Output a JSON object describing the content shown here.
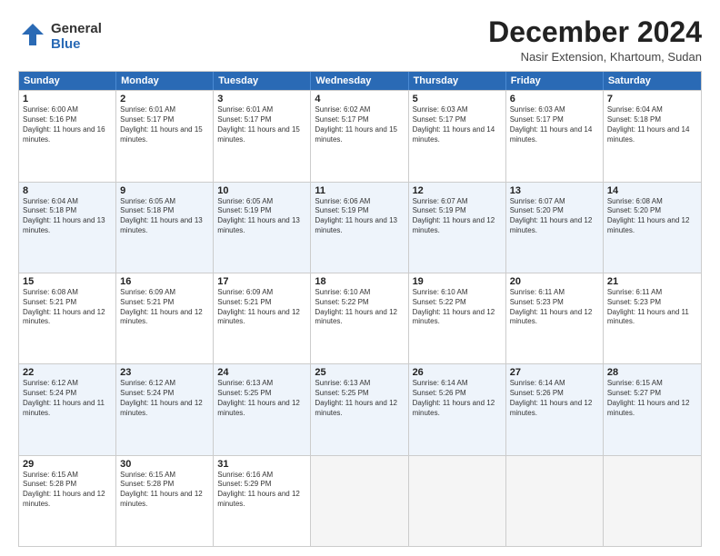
{
  "header": {
    "logo_general": "General",
    "logo_blue": "Blue",
    "month_title": "December 2024",
    "subtitle": "Nasir Extension, Khartoum, Sudan"
  },
  "weekdays": [
    "Sunday",
    "Monday",
    "Tuesday",
    "Wednesday",
    "Thursday",
    "Friday",
    "Saturday"
  ],
  "weeks": [
    [
      {
        "day": "1",
        "sunrise": "6:00 AM",
        "sunset": "5:16 PM",
        "daylight": "11 hours and 16 minutes."
      },
      {
        "day": "2",
        "sunrise": "6:01 AM",
        "sunset": "5:17 PM",
        "daylight": "11 hours and 15 minutes."
      },
      {
        "day": "3",
        "sunrise": "6:01 AM",
        "sunset": "5:17 PM",
        "daylight": "11 hours and 15 minutes."
      },
      {
        "day": "4",
        "sunrise": "6:02 AM",
        "sunset": "5:17 PM",
        "daylight": "11 hours and 15 minutes."
      },
      {
        "day": "5",
        "sunrise": "6:03 AM",
        "sunset": "5:17 PM",
        "daylight": "11 hours and 14 minutes."
      },
      {
        "day": "6",
        "sunrise": "6:03 AM",
        "sunset": "5:17 PM",
        "daylight": "11 hours and 14 minutes."
      },
      {
        "day": "7",
        "sunrise": "6:04 AM",
        "sunset": "5:18 PM",
        "daylight": "11 hours and 14 minutes."
      }
    ],
    [
      {
        "day": "8",
        "sunrise": "6:04 AM",
        "sunset": "5:18 PM",
        "daylight": "11 hours and 13 minutes."
      },
      {
        "day": "9",
        "sunrise": "6:05 AM",
        "sunset": "5:18 PM",
        "daylight": "11 hours and 13 minutes."
      },
      {
        "day": "10",
        "sunrise": "6:05 AM",
        "sunset": "5:19 PM",
        "daylight": "11 hours and 13 minutes."
      },
      {
        "day": "11",
        "sunrise": "6:06 AM",
        "sunset": "5:19 PM",
        "daylight": "11 hours and 13 minutes."
      },
      {
        "day": "12",
        "sunrise": "6:07 AM",
        "sunset": "5:19 PM",
        "daylight": "11 hours and 12 minutes."
      },
      {
        "day": "13",
        "sunrise": "6:07 AM",
        "sunset": "5:20 PM",
        "daylight": "11 hours and 12 minutes."
      },
      {
        "day": "14",
        "sunrise": "6:08 AM",
        "sunset": "5:20 PM",
        "daylight": "11 hours and 12 minutes."
      }
    ],
    [
      {
        "day": "15",
        "sunrise": "6:08 AM",
        "sunset": "5:21 PM",
        "daylight": "11 hours and 12 minutes."
      },
      {
        "day": "16",
        "sunrise": "6:09 AM",
        "sunset": "5:21 PM",
        "daylight": "11 hours and 12 minutes."
      },
      {
        "day": "17",
        "sunrise": "6:09 AM",
        "sunset": "5:21 PM",
        "daylight": "11 hours and 12 minutes."
      },
      {
        "day": "18",
        "sunrise": "6:10 AM",
        "sunset": "5:22 PM",
        "daylight": "11 hours and 12 minutes."
      },
      {
        "day": "19",
        "sunrise": "6:10 AM",
        "sunset": "5:22 PM",
        "daylight": "11 hours and 12 minutes."
      },
      {
        "day": "20",
        "sunrise": "6:11 AM",
        "sunset": "5:23 PM",
        "daylight": "11 hours and 12 minutes."
      },
      {
        "day": "21",
        "sunrise": "6:11 AM",
        "sunset": "5:23 PM",
        "daylight": "11 hours and 11 minutes."
      }
    ],
    [
      {
        "day": "22",
        "sunrise": "6:12 AM",
        "sunset": "5:24 PM",
        "daylight": "11 hours and 11 minutes."
      },
      {
        "day": "23",
        "sunrise": "6:12 AM",
        "sunset": "5:24 PM",
        "daylight": "11 hours and 12 minutes."
      },
      {
        "day": "24",
        "sunrise": "6:13 AM",
        "sunset": "5:25 PM",
        "daylight": "11 hours and 12 minutes."
      },
      {
        "day": "25",
        "sunrise": "6:13 AM",
        "sunset": "5:25 PM",
        "daylight": "11 hours and 12 minutes."
      },
      {
        "day": "26",
        "sunrise": "6:14 AM",
        "sunset": "5:26 PM",
        "daylight": "11 hours and 12 minutes."
      },
      {
        "day": "27",
        "sunrise": "6:14 AM",
        "sunset": "5:26 PM",
        "daylight": "11 hours and 12 minutes."
      },
      {
        "day": "28",
        "sunrise": "6:15 AM",
        "sunset": "5:27 PM",
        "daylight": "11 hours and 12 minutes."
      }
    ],
    [
      {
        "day": "29",
        "sunrise": "6:15 AM",
        "sunset": "5:28 PM",
        "daylight": "11 hours and 12 minutes."
      },
      {
        "day": "30",
        "sunrise": "6:15 AM",
        "sunset": "5:28 PM",
        "daylight": "11 hours and 12 minutes."
      },
      {
        "day": "31",
        "sunrise": "6:16 AM",
        "sunset": "5:29 PM",
        "daylight": "11 hours and 12 minutes."
      },
      null,
      null,
      null,
      null
    ]
  ]
}
